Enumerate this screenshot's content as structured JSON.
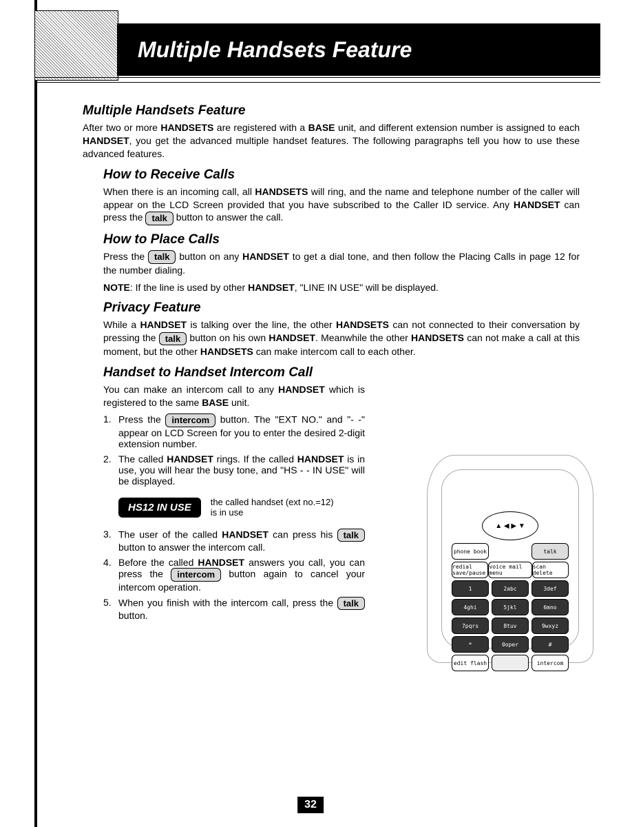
{
  "header": {
    "title": "Multiple Handsets Feature"
  },
  "section1": {
    "heading": "Multiple Handsets Feature",
    "p1a": "After two or more ",
    "p1b": "HANDSETS",
    "p1c": " are registered with a ",
    "p1d": "BASE",
    "p1e": " unit, and different extension number is assigned to each ",
    "p1f": "HANDSET",
    "p1g": ", you get the advanced multiple handset features. The following paragraphs tell you how to use these advanced features."
  },
  "receive": {
    "heading": "How to Receive Calls",
    "p1a": "When there is an incoming call, all ",
    "p1b": "HANDSETS",
    "p1c": " will ring, and the name and telephone number of the caller will appear on the LCD Screen provided that you have subscribed to the Caller ID service. Any ",
    "p1d": "HANDSET",
    "p1e": " can press the ",
    "btn": "talk",
    "p1f": " button to answer the call."
  },
  "place": {
    "heading": "How to Place Calls",
    "p1a": "Press the ",
    "btn": "talk",
    "p1b": " button on any ",
    "p1c": "HANDSET",
    "p1d": " to get a dial tone, and then follow the Placing Calls in page 12 for the number dialing.",
    "note_label": "NOTE",
    "note_a": ":   If the line is used by other ",
    "note_b": "HANDSET",
    "note_c": ", \"LINE IN USE\" will be displayed."
  },
  "privacy": {
    "heading": "Privacy Feature",
    "p1a": "While a ",
    "p1b": "HANDSET",
    "p1c": " is talking over the line, the other ",
    "p1d": "HANDSETS",
    "p1e": " can not connected to their conversation by pressing the ",
    "btn": "talk",
    "p1f": " button on his own ",
    "p1g": "HANDSET",
    "p1h": ". Meanwhile the other ",
    "p1i": "HANDSETS",
    "p1j": " can not make a call at this moment, but the other ",
    "p1k": "HANDSETS",
    "p1l": " can make intercom call to each other."
  },
  "intercom": {
    "heading": "Handset to Handset Intercom Call",
    "intro_a": "You can make an intercom call to any ",
    "intro_b": "HANDSET",
    "intro_c": " which is registered to the same ",
    "intro_d": "BASE",
    "intro_e": " unit.",
    "s1n": "1.",
    "s1a": "Press the ",
    "s1btn": "intercom",
    "s1b": " button. The \"EXT NO.\" and \"- -\" appear on LCD Screen for you to enter the desired 2-digit extension number.",
    "s2n": "2.",
    "s2a": "The called ",
    "s2b": "HANDSET",
    "s2c": " rings. If the called ",
    "s2d": "HANDSET",
    "s2e": " is in use, you will hear the busy tone, and \"HS - - IN USE\" will be displayed.",
    "lcd": "HS12 IN USE",
    "lcd_note1": "the called handset (ext no.=12)",
    "lcd_note2": "is in use",
    "s3n": "3.",
    "s3a": "The user of the called ",
    "s3b": "HANDSET",
    "s3c": " can press his ",
    "s3btn": "talk",
    "s3d": " button to answer the intercom call.",
    "s4n": "4.",
    "s4a": "Before the called ",
    "s4b": "HANDSET",
    "s4c": " answers you call, you can press the ",
    "s4btn": "intercom",
    "s4d": " button again to cancel your intercom operation.",
    "s5n": "5.",
    "s5a": "When you finish with the intercom call, press the ",
    "s5btn": "talk",
    "s5b": " button."
  },
  "handset_keys": {
    "phone_book": "phone book",
    "talk": "talk",
    "redial": "redial save/pause",
    "menu": "voice mail menu",
    "scan": "scan delete",
    "k1": "1",
    "k2": "2abc",
    "k3": "3def",
    "k4": "4ghi",
    "k5": "5jkl",
    "k6": "6mno",
    "k7": "7pqrs",
    "k8": "8tuv",
    "k9": "9wxyz",
    "kstar": "*",
    "k0": "0oper",
    "khash": "#",
    "edit": "edit flash",
    "intercom": "intercom"
  },
  "page_number": "32"
}
